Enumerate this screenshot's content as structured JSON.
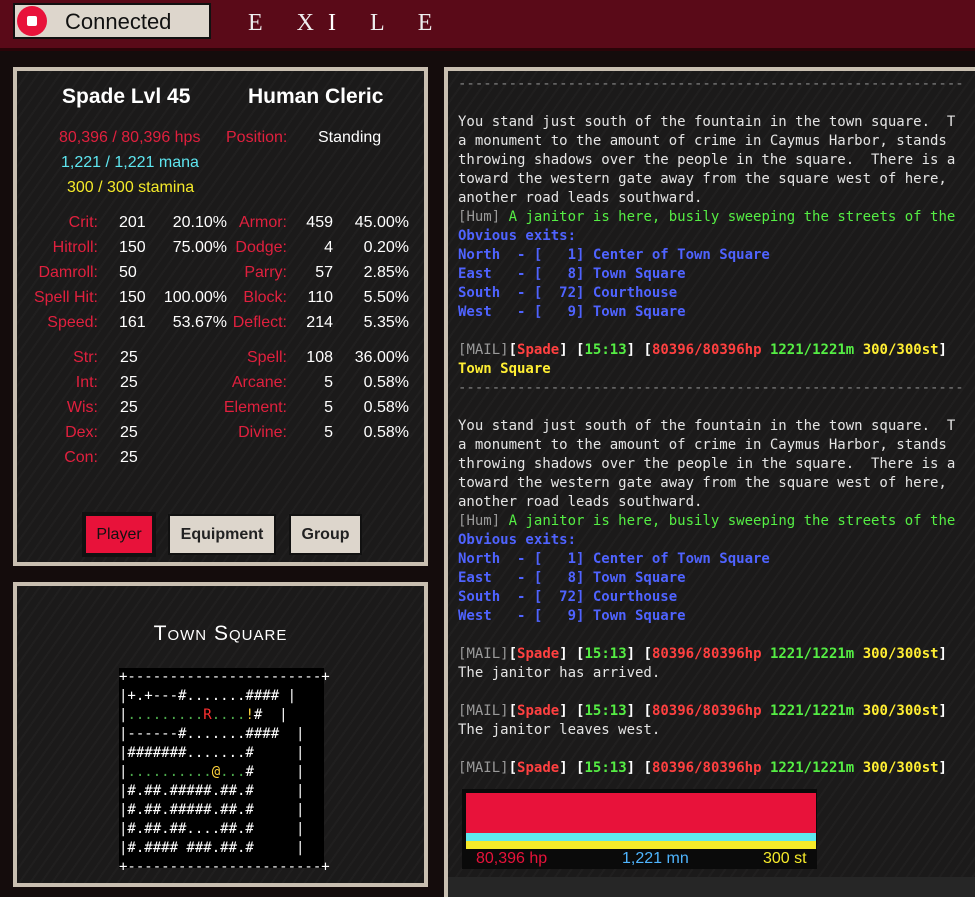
{
  "connection": {
    "label": "Connected",
    "icon": "stop-icon"
  },
  "logo": {
    "text": "EXILE"
  },
  "character": {
    "name": "Spade Lvl 45",
    "class": "Human Cleric",
    "hps": "80,396 / 80,396 hps",
    "mana": "1,221 / 1,221 mana",
    "stamina": "300 / 300 stamina",
    "position_label": "Position:",
    "position_value": "Standing",
    "stats_left": [
      {
        "label": "Crit:",
        "v1": "201",
        "v2": "20.10%"
      },
      {
        "label": "Hitroll:",
        "v1": "150",
        "v2": "75.00%"
      },
      {
        "label": "Damroll:",
        "v1": "50",
        "v2": ""
      },
      {
        "label": "Spell Hit:",
        "v1": "150",
        "v2": "100.00%"
      },
      {
        "label": "Speed:",
        "v1": "161",
        "v2": "53.67%"
      }
    ],
    "stats_right": [
      {
        "label": "Armor:",
        "v1": "459",
        "v2": "45.00%"
      },
      {
        "label": "Dodge:",
        "v1": "4",
        "v2": "0.20%"
      },
      {
        "label": "Parry:",
        "v1": "57",
        "v2": "2.85%"
      },
      {
        "label": "Block:",
        "v1": "110",
        "v2": "5.50%"
      },
      {
        "label": "Deflect:",
        "v1": "214",
        "v2": "5.35%"
      }
    ],
    "attrs": [
      {
        "label": "Str:",
        "v": "25"
      },
      {
        "label": "Int:",
        "v": "25"
      },
      {
        "label": "Wis:",
        "v": "25"
      },
      {
        "label": "Dex:",
        "v": "25"
      },
      {
        "label": "Con:",
        "v": "25"
      }
    ],
    "spells": [
      {
        "label": "Spell:",
        "v1": "108",
        "v2": "36.00%"
      },
      {
        "label": "Arcane:",
        "v1": "5",
        "v2": "0.58%"
      },
      {
        "label": "Element:",
        "v1": "5",
        "v2": "0.58%"
      },
      {
        "label": "Divine:",
        "v1": "5",
        "v2": "0.58%"
      }
    ],
    "tabs": [
      "Player",
      "Equipment",
      "Group"
    ]
  },
  "map": {
    "title": "Town Square"
  },
  "log": {
    "desc": [
      "You stand just south of the fountain in the town square.  T",
      "a monument to the amount of crime in Caymus Harbor, stands",
      "throwing shadows over the people in the square.  There is a",
      "toward the western gate away from the square west of here,",
      "another road leads southward."
    ],
    "mob_tag": "Hum",
    "mob_text": " A janitor is here, busily sweeping the streets of the",
    "exits_label": "Obvious exits:",
    "exits": [
      "North  - [   1] Center of Town Square",
      "East   - [   8] Town Square",
      "South  - [  72] Courthouse",
      "West   - [   9] Town Square"
    ],
    "prompt": {
      "mail": "MAIL",
      "name": "Spade",
      "time": "15:13",
      "hp": "80396/80396hp",
      "mana": "1221/1221m",
      "st": "300/300st"
    },
    "room": "Town Square",
    "janitor_arrive": "The janitor has arrived.",
    "janitor_leave": "The janitor leaves west."
  },
  "vitals": {
    "hp_label": "80,396 hp",
    "mn_label": "1,221 mn",
    "st_label": "300 st",
    "hp_frac": 1.0,
    "mn_frac": 1.0,
    "st_frac": 1.0
  },
  "colors": {
    "hp": "#e8123a",
    "mana": "#60e8ef",
    "stamina": "#f5ea2a",
    "brand": "#5a0a18"
  }
}
